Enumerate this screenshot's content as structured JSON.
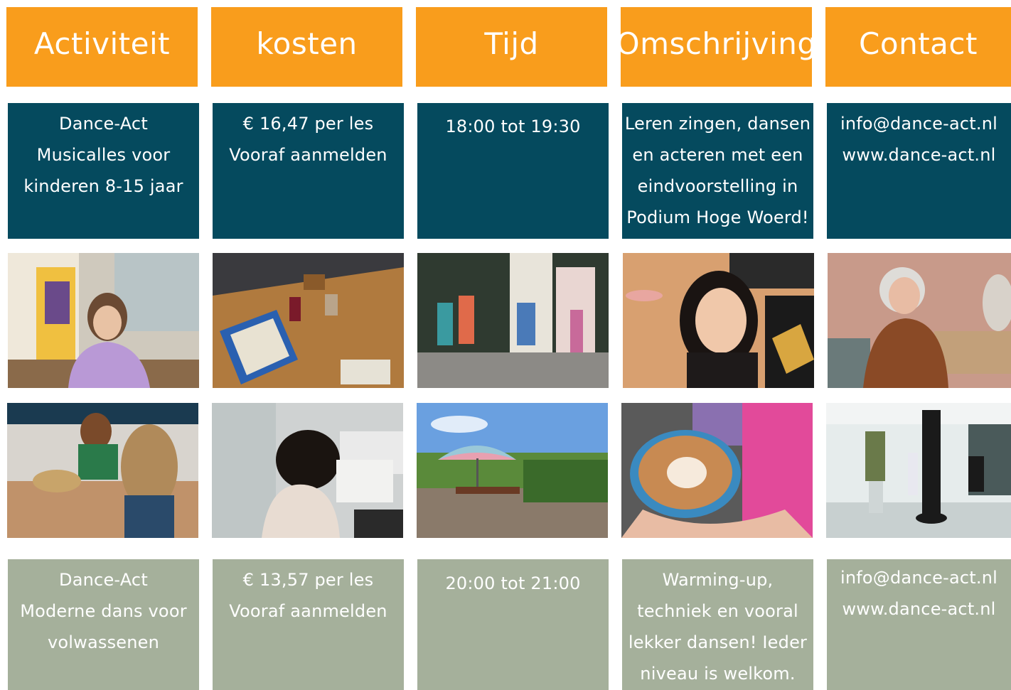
{
  "headers": [
    "Activiteit",
    "kosten",
    "Tijd",
    "Omschrijving",
    "Contact"
  ],
  "row1": {
    "activiteit": [
      "Dance-Act",
      "Musicalles voor",
      "kinderen 8-15 jaar"
    ],
    "kosten": [
      "€ 16,47 per les",
      "Vooraf aanmelden"
    ],
    "tijd": [
      "18:00 tot 19:30"
    ],
    "omschrijving": [
      "Leren zingen, dansen",
      "en acteren met een",
      "eindvoorstelling in",
      "Podium Hoge Woerd!"
    ],
    "contact": [
      "info@dance-act.nl",
      "www.dance-act.nl"
    ]
  },
  "row2": {
    "activiteit": [
      "Dance-Act",
      "Moderne dans voor",
      "volwassenen"
    ],
    "kosten": [
      "€ 13,57 per les",
      "Vooraf aanmelden"
    ],
    "tijd": [
      "20:00 tot 21:00"
    ],
    "omschrijving": [
      "Warming-up,",
      "techniek en vooral",
      "lekker dansen! Ieder",
      "niveau is welkom."
    ],
    "contact": [
      "info@dance-act.nl",
      "www.dance-act.nl"
    ]
  },
  "photos": [
    "photo-woman-purple-sweater",
    "photo-table-with-game-box-and-drinks",
    "photo-dancers-in-room",
    "photo-smiling-woman-cafe",
    "photo-elderly-woman-at-table",
    "photo-children-baking",
    "photo-sewing-machine-workshop",
    "photo-garden-terrace-picnic-table",
    "photo-cappuccino-cup-in-hand",
    "photo-boxing-class"
  ],
  "colors": {
    "orange": "#f99d1c",
    "dark_teal": "#054a5e",
    "sage": "#a5b09b"
  }
}
